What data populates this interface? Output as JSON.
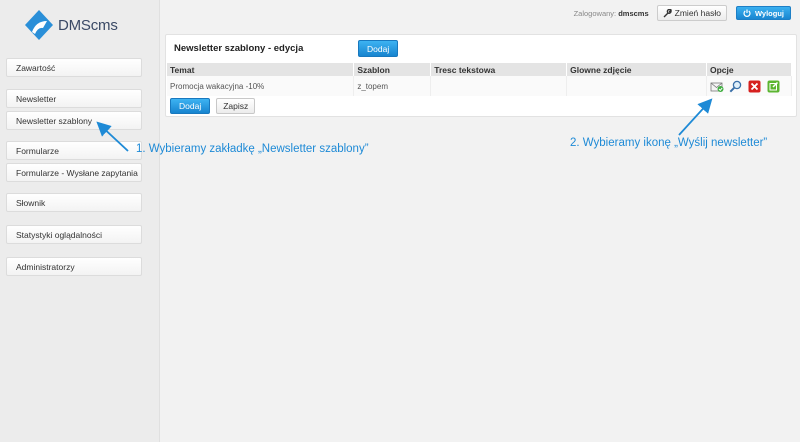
{
  "app": {
    "logo_text": "DMScms"
  },
  "topbar": {
    "logged_label": "Zalogowany:",
    "username": "dmscms",
    "change_password_label": "Zmień hasło",
    "logout_label": "Wyloguj"
  },
  "sidebar": {
    "items": [
      {
        "label": "Zawartość"
      },
      {
        "label": "Newsletter"
      },
      {
        "label": "Newsletter szablony"
      },
      {
        "label": "Formularze"
      },
      {
        "label": "Formularze - Wysłane zapytania"
      },
      {
        "label": "Słownik"
      },
      {
        "label": "Statystyki oglądalności"
      },
      {
        "label": "Administratorzy"
      }
    ]
  },
  "panel": {
    "title": "Newsletter szablony - edycja",
    "add_label": "Dodaj",
    "columns": [
      "Temat",
      "Szablon",
      "Tresc tekstowa",
      "Glowne zdjęcie",
      "Opcje"
    ],
    "rows": [
      {
        "temat": "Promocja wakacyjna -10%",
        "szablon": "z_topem",
        "tresc": "",
        "zdjecie": ""
      }
    ],
    "option_icons": [
      "send-newsletter-icon",
      "preview-magnifier-icon",
      "delete-icon",
      "edit-icon"
    ],
    "bottom_add_label": "Dodaj",
    "save_label": "Zapisz"
  },
  "annotations": {
    "step1": "1. Wybieramy zakładkę „Newsletter szablony”",
    "step2": "2. Wybieramy ikonę „Wyślij newsletter”"
  },
  "colors": {
    "accent": "#1e8ad6",
    "button_blue": "#1784cf",
    "logo": "#3b4a66"
  }
}
